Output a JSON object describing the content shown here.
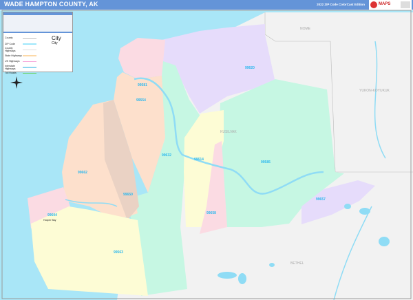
{
  "header": {
    "title": "WADE HAMPTON COUNTY, AK",
    "edition": "2022 ZIP Code ColorCast Edition",
    "brand": "MAPS"
  },
  "legend": {
    "items": [
      "County",
      "ZIP Code",
      "County Highways",
      "State Highways",
      "US Highways",
      "Interstate Highways",
      "Toll Roads"
    ],
    "city_sample": "City",
    "city_sample_small": "City"
  },
  "map": {
    "colors": {
      "ocean": "#a9e6f7",
      "neighbor_land": "#f2f2f2",
      "water": "#8fdcf5"
    },
    "zip_labels": [
      "99581",
      "99620",
      "99554",
      "99632",
      "99614",
      "99585",
      "99662",
      "99650",
      "99604",
      "99563",
      "99658",
      "99657"
    ],
    "neighbor_counties": [
      "NOME",
      "YUKON-KOYUKUK",
      "KUSILVAK",
      "BETHEL"
    ],
    "towns": [
      "Hooper Bay"
    ]
  }
}
